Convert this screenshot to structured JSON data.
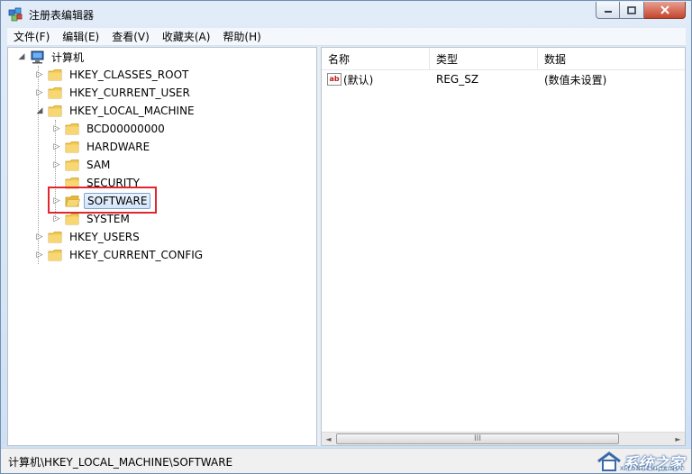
{
  "window": {
    "title": "注册表编辑器",
    "controls": [
      "minimize",
      "maximize",
      "close"
    ]
  },
  "menu": [
    "文件(F)",
    "编辑(E)",
    "查看(V)",
    "收藏夹(A)",
    "帮助(H)"
  ],
  "tree": {
    "root": "计算机",
    "hives": [
      {
        "label": "HKEY_CLASSES_ROOT",
        "expander": "▷"
      },
      {
        "label": "HKEY_CURRENT_USER",
        "expander": "▷"
      },
      {
        "label": "HKEY_LOCAL_MACHINE",
        "expander": "◢",
        "children": [
          {
            "label": "BCD00000000",
            "expander": "▷"
          },
          {
            "label": "HARDWARE",
            "expander": "▷"
          },
          {
            "label": "SAM",
            "expander": "▷"
          },
          {
            "label": "SECURITY",
            "expander": ""
          },
          {
            "label": "SOFTWARE",
            "expander": "▷",
            "selected": true
          },
          {
            "label": "SYSTEM",
            "expander": "▷"
          }
        ]
      },
      {
        "label": "HKEY_USERS",
        "expander": "▷"
      },
      {
        "label": "HKEY_CURRENT_CONFIG",
        "expander": "▷"
      }
    ]
  },
  "list": {
    "columns": [
      "名称",
      "类型",
      "数据"
    ],
    "rows": [
      {
        "icon": "ab",
        "name": "(默认)",
        "type": "REG_SZ",
        "data": "(数值未设置)"
      }
    ]
  },
  "scrollbar": {
    "left_arrow": "◄",
    "right_arrow": "►",
    "grip": "III"
  },
  "status": {
    "path": "计算机\\HKEY_LOCAL_MACHINE\\SOFTWARE"
  },
  "watermark": {
    "text": "系统之家",
    "sub": "XITONGZHIJIA.NET"
  },
  "colors": {
    "highlight_border": "#e0262f",
    "folder": "#f3c84b"
  }
}
